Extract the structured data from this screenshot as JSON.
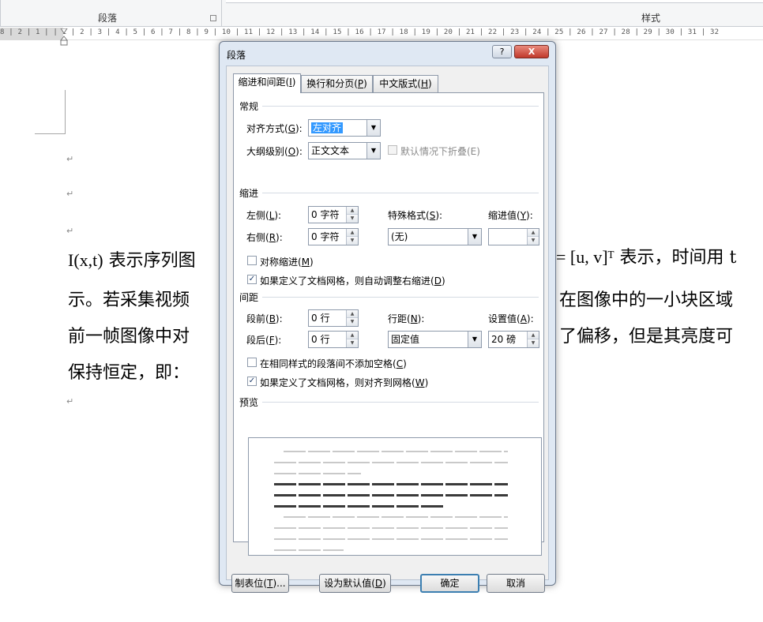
{
  "ribbon": {
    "paragraph_group": "段落",
    "styles_group": "样式"
  },
  "ruler": {
    "text": "8 | 2 | 1 |  | 1 | 2 | 3 | 4 | 5 | 6 | 7 | 8 | 9 | 10 | 11 | 12 | 13 | 14 | 15 | 16 | 17 | 18 | 19 | 20 | 21 | 22 | 23 | 24 | 25 | 26 | 27 | 28 | 29 | 30 | 31 | 32"
  },
  "document": {
    "paragraph_mark": "↵",
    "math_i": "I(x,t)",
    "line1_left": "表示序列图",
    "math_uv": "= [u, v]ᵀ",
    "line1_right": "表示，时间用 t",
    "line2_left": "示。若采集视频",
    "line2_right": "在图像中的一小块区域",
    "line3_left": "前一帧图像中对",
    "line3_right": "了偏移，但是其亮度可",
    "line4": "保持恒定，即："
  },
  "dialog": {
    "title": "段落",
    "help": "?",
    "close": "X",
    "tabs": [
      {
        "label": "缩进和间距(",
        "key": "I",
        "end": ")"
      },
      {
        "label": "换行和分页(",
        "key": "P",
        "end": ")"
      },
      {
        "label": "中文版式(",
        "key": "H",
        "end": ")"
      }
    ],
    "general": {
      "heading": "常规",
      "alignment_label": "对齐方式(",
      "alignment_key": "G",
      "alignment_end": "):",
      "alignment_value": "左对齐",
      "outline_label": "大纲级别(",
      "outline_key": "O",
      "outline_end": "):",
      "outline_value": "正文文本",
      "collapse_label": "默认情况下折叠(E)"
    },
    "indent": {
      "heading": "缩进",
      "left_label": "左侧(",
      "left_key": "L",
      "left_end": "):",
      "left_value": "0 字符",
      "right_label": "右侧(",
      "right_key": "R",
      "right_end": "):",
      "right_value": "0 字符",
      "special_label": "特殊格式(",
      "special_key": "S",
      "special_end": "):",
      "special_value": "(无)",
      "by_label": "缩进值(",
      "by_key": "Y",
      "by_end": "):",
      "by_value": "",
      "mirror_label": "对称缩进(",
      "mirror_key": "M",
      "mirror_end": ")",
      "mirror_checked": false,
      "autoadjust_label": "如果定义了文档网格，则自动调整右缩进(",
      "autoadjust_key": "D",
      "autoadjust_end": ")",
      "autoadjust_checked": true
    },
    "spacing": {
      "heading": "间距",
      "before_label": "段前(",
      "before_key": "B",
      "before_end": "):",
      "before_value": "0 行",
      "after_label": "段后(",
      "after_key": "F",
      "after_end": "):",
      "after_value": "0 行",
      "line_label": "行距(",
      "line_key": "N",
      "line_end": "):",
      "line_value": "固定值",
      "at_label": "设置值(",
      "at_key": "A",
      "at_end": "):",
      "at_value": "20 磅",
      "nospace_label": "在相同样式的段落间不添加空格(",
      "nospace_key": "C",
      "nospace_end": ")",
      "nospace_checked": false,
      "snap_label": "如果定义了文档网格，则对齐到网格(",
      "snap_key": "W",
      "snap_end": ")",
      "snap_checked": true
    },
    "preview": {
      "heading": "预览"
    },
    "buttons": {
      "tabs_label": "制表位(",
      "tabs_key": "T",
      "tabs_end": ")...",
      "default_label": "设为默认值(",
      "default_key": "D",
      "default_end": ")",
      "ok": "确定",
      "cancel": "取消"
    }
  }
}
